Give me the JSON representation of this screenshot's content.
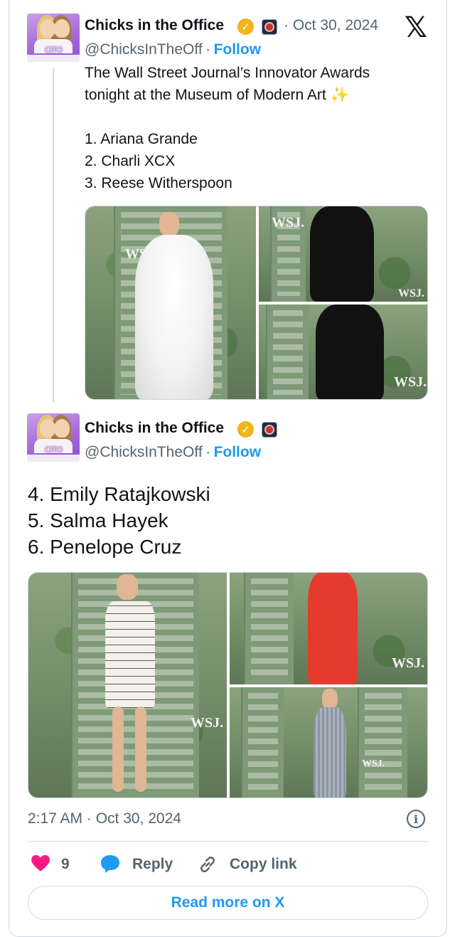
{
  "tweet1": {
    "name": "Chicks in the Office",
    "handle": "@ChicksInTheOff",
    "separator": "·",
    "follow": "Follow",
    "date": "· Oct 30, 2024",
    "line1": "The Wall Street Journal’s Innovator Awards",
    "line2": "tonight at the Museum of Modern Art ✨",
    "list": [
      "1. Ariana Grande",
      "2. Charli XCX",
      "3. Reese Witherspoon"
    ],
    "media_logos": [
      "WSJ.",
      "WSJ.",
      "WSJ.",
      "WSJ."
    ]
  },
  "tweet2": {
    "name": "Chicks in the Office",
    "handle": "@ChicksInTheOff",
    "separator": "·",
    "follow": "Follow",
    "list": [
      "4. Emily Ratajkowski",
      "5. Salma Hayek",
      "6. Penelope Cruz"
    ],
    "media_logos": [
      "WSJ.",
      "WSJ.",
      "WSJ."
    ]
  },
  "avatar_text": "CITO",
  "footer": {
    "timestamp": "2:17 AM · Oct 30, 2024",
    "likes": "9",
    "reply": "Reply",
    "copy_link": "Copy link",
    "read_more": "Read more on X"
  },
  "colors": {
    "accent": "#1d9bf0",
    "like": "#f91880",
    "verified": "#f2b31c",
    "text": "#0f1419",
    "muted": "#536471",
    "border": "#cfd9de"
  },
  "icons": {
    "logo": "x-logo-icon",
    "verified": "verified-badge-icon",
    "affiliate": "affiliate-badge-icon",
    "like": "heart-icon",
    "reply": "reply-bubble-icon",
    "copy": "link-icon",
    "info": "info-icon"
  }
}
